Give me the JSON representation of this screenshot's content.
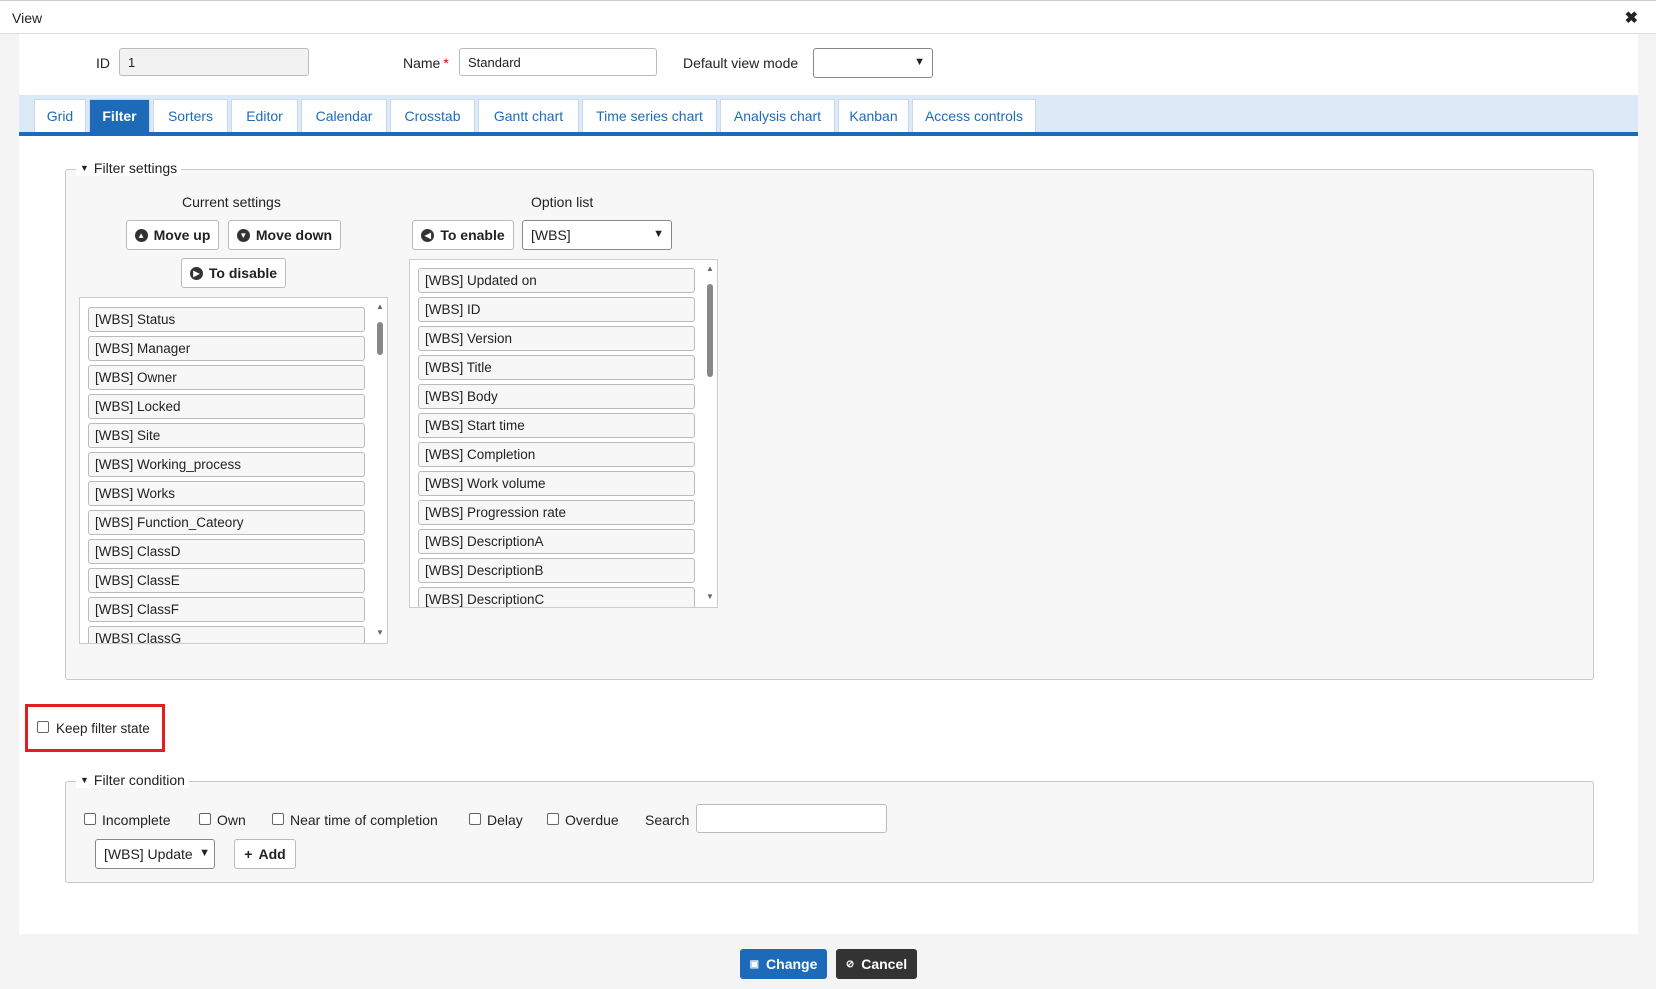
{
  "window": {
    "title": "View",
    "close_icon": "close-icon"
  },
  "header": {
    "id_label": "ID",
    "id_value": "1",
    "name_label": "Name",
    "name_required": "*",
    "name_value": "Standard",
    "default_view_mode_label": "Default view mode",
    "default_view_mode_value": ""
  },
  "tabs": [
    "Grid",
    "Filter",
    "Sorters",
    "Editor",
    "Calendar",
    "Crosstab",
    "Gantt chart",
    "Time series chart",
    "Analysis chart",
    "Kanban",
    "Access controls"
  ],
  "active_tab": "Filter",
  "filter_settings": {
    "legend": "Filter settings",
    "current_settings_label": "Current settings",
    "move_up": "Move up",
    "move_down": "Move down",
    "to_disable": "To disable",
    "current_items": [
      "[WBS] Status",
      "[WBS] Manager",
      "[WBS] Owner",
      "[WBS] Locked",
      "[WBS] Site",
      "[WBS] Working_process",
      "[WBS] Works",
      "[WBS] Function_Cateory",
      "[WBS] ClassD",
      "[WBS] ClassE",
      "[WBS] ClassF",
      "[WBS] ClassG"
    ],
    "option_list_label": "Option list",
    "to_enable": "To enable",
    "option_select_value": "[WBS]",
    "option_items": [
      "[WBS] Updated on",
      "[WBS] ID",
      "[WBS] Version",
      "[WBS] Title",
      "[WBS] Body",
      "[WBS] Start time",
      "[WBS] Completion",
      "[WBS] Work volume",
      "[WBS] Progression rate",
      "[WBS] DescriptionA",
      "[WBS] DescriptionB",
      "[WBS] DescriptionC"
    ]
  },
  "keep_filter_state": {
    "label": "Keep filter state",
    "checked": false
  },
  "filter_condition": {
    "legend": "Filter condition",
    "checkboxes": [
      "Incomplete",
      "Own",
      "Near time of completion",
      "Delay",
      "Overdue"
    ],
    "search_label": "Search",
    "search_value": "",
    "column_select_value": "[WBS] Update",
    "add_label": "Add"
  },
  "actions": {
    "change_label": "Change",
    "cancel_label": "Cancel"
  },
  "colors": {
    "accent": "#1d6bb8",
    "highlight": "#e02020",
    "cancel": "#333333"
  }
}
